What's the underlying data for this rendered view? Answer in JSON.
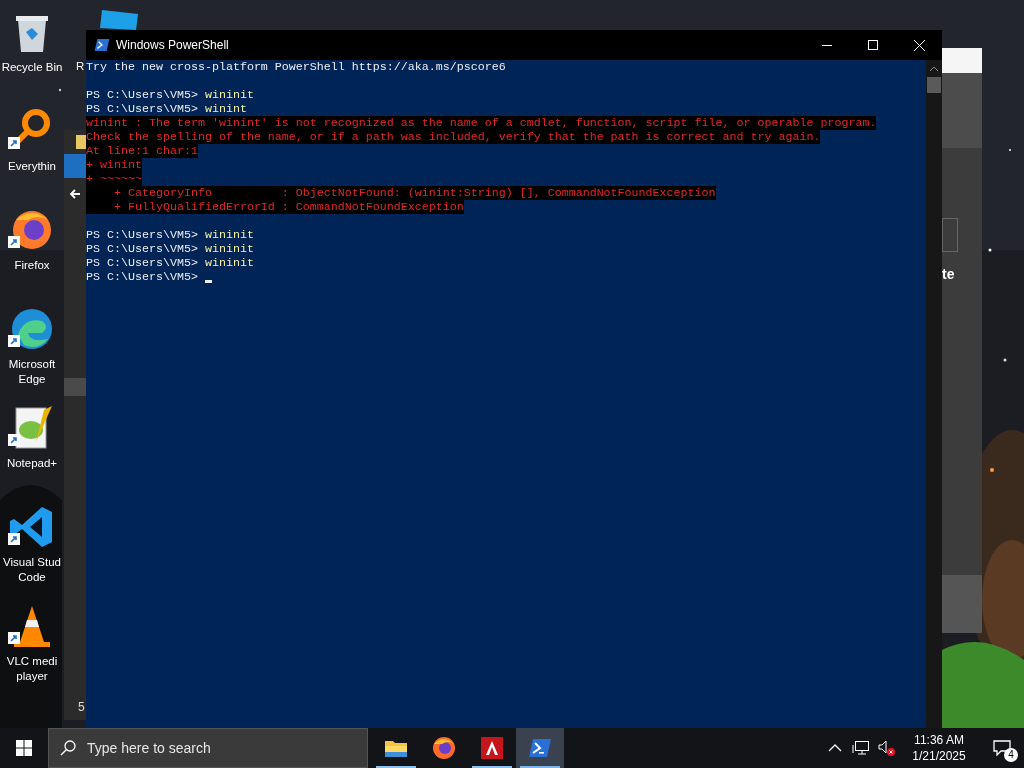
{
  "desktop_icons": [
    {
      "kind": "trash",
      "label": [
        "Recycle Bin"
      ]
    },
    {
      "kind": "magnifier",
      "label": [
        "Everythin"
      ]
    },
    {
      "kind": "globe",
      "label": [
        "Firefox"
      ]
    },
    {
      "kind": "wave",
      "label": [
        "Microsoft",
        "Edge"
      ]
    },
    {
      "kind": "notepad",
      "label": [
        "Notepad+"
      ]
    },
    {
      "kind": "ribbon",
      "label": [
        "Visual Stud",
        "Code"
      ]
    },
    {
      "kind": "cone",
      "label": [
        "VLC medi",
        "player"
      ]
    }
  ],
  "partial_label": "R",
  "background_window": {
    "right_text": "te",
    "left_text": "5"
  },
  "window": {
    "title": "Windows PowerShell"
  },
  "console": {
    "lines": [
      {
        "kind": "output",
        "text": "Try the new cross-platform PowerShell https://aka.ms/pscore6"
      },
      {
        "kind": "blank"
      },
      {
        "kind": "prompt",
        "prompt": "PS C:\\Users\\VM5>",
        "command": "wininit"
      },
      {
        "kind": "prompt",
        "prompt": "PS C:\\Users\\VM5>",
        "command": "winint"
      },
      {
        "kind": "error",
        "text": "winint : The term 'winint' is not recognized as the name of a cmdlet, function, script file, or operable program."
      },
      {
        "kind": "error",
        "text": "Check the spelling of the name, or if a path was included, verify that the path is correct and try again."
      },
      {
        "kind": "error",
        "text": "At line:1 char:1"
      },
      {
        "kind": "error",
        "text": "+ winint"
      },
      {
        "kind": "error",
        "text": "+ ~~~~~~"
      },
      {
        "kind": "error",
        "text": "    + CategoryInfo          : ObjectNotFound: (winint:String) [], CommandNotFoundException"
      },
      {
        "kind": "error",
        "text": "    + FullyQualifiedErrorId : CommandNotFoundException"
      },
      {
        "kind": "blank"
      },
      {
        "kind": "prompt",
        "prompt": "PS C:\\Users\\VM5>",
        "command": "wininit"
      },
      {
        "kind": "prompt",
        "prompt": "PS C:\\Users\\VM5>",
        "command": "wininit"
      },
      {
        "kind": "prompt",
        "prompt": "PS C:\\Users\\VM5>",
        "command": "wininit"
      },
      {
        "kind": "prompt",
        "prompt": "PS C:\\Users\\VM5>",
        "cursor": true
      }
    ]
  },
  "taskbar": {
    "search": {
      "placeholder": "Type here to search"
    },
    "apps": [
      {
        "kind": "folder",
        "running": true,
        "selected": false
      },
      {
        "kind": "globe",
        "running": false,
        "selected": false
      },
      {
        "kind": "document",
        "running": true,
        "selected": false
      },
      {
        "kind": "terminal",
        "running": true,
        "selected": true
      }
    ],
    "time": "11:36 AM",
    "date": "1/21/2025",
    "notifications": "4"
  }
}
